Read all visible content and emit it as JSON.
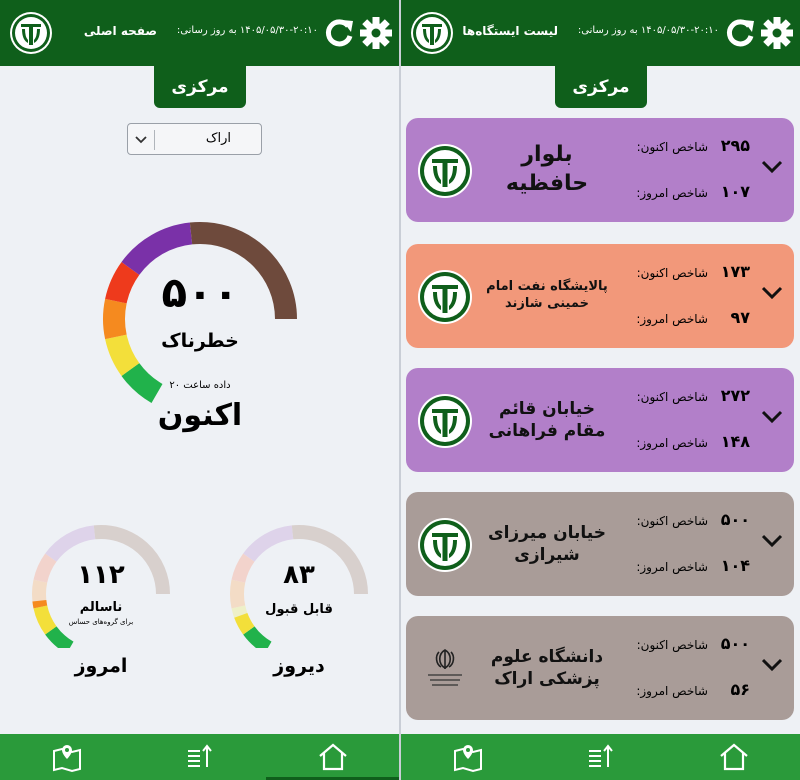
{
  "header_common": {
    "updated_label": "به روز رسانی:",
    "updated_value": "۱۴۰۵/۰۵/۳۰-۲۰:۱۰"
  },
  "left": {
    "header_title": "صفحه اصلی",
    "region": "مرکزی",
    "city_select": {
      "selected": "اراک"
    },
    "current": {
      "value": "۵۰۰",
      "value_num": 500,
      "status": "خطرناک",
      "data_time": "داده ساعت ۲۰",
      "label": "اکنون"
    },
    "today": {
      "value": "۱۱۲",
      "value_num": 112,
      "status": "ناسالم",
      "sub": "برای گروه‌های حساس",
      "label": "امروز"
    },
    "yesterday": {
      "value": "۸۳",
      "value_num": 83,
      "status": "قابل قبول",
      "label": "دیروز"
    }
  },
  "right": {
    "header_title": "لیست ایستگاه‌ها",
    "region": "مرکزی",
    "now_label": "شاخص اکنون:",
    "today_label": "شاخص امروز:",
    "stations": [
      {
        "name": "بلوار حافظیه",
        "now": "۲۹۵",
        "today": "۱۰۷",
        "color": "#b27fc9",
        "logo": "doe",
        "name_size": "big"
      },
      {
        "name": "پالایشگاه نفت امام خمینی شازند",
        "now": "۱۷۳",
        "today": "۹۷",
        "color": "#f2987a",
        "logo": "doe",
        "name_size": "small"
      },
      {
        "name": "خیابان قائم مقام فراهانی",
        "now": "۲۷۲",
        "today": "۱۴۸",
        "color": "#b27fc9",
        "logo": "doe",
        "name_size": "mid"
      },
      {
        "name": "خیابان میرزای شیرازی",
        "now": "۵۰۰",
        "today": "۱۰۴",
        "color": "#a99c98",
        "logo": "doe",
        "name_size": "mid"
      },
      {
        "name": "دانشگاه علوم پزشکی اراک",
        "now": "۵۰۰",
        "today": "۵۶",
        "color": "#a99c98",
        "logo": "emblem",
        "name_size": "mid"
      }
    ]
  },
  "colors": {
    "header_green": "#0f5f1b",
    "nav_green": "#2a9a3a",
    "aqi_good": "#21b24b",
    "aqi_moderate": "#f3df3a",
    "aqi_usg": "#f58a1f",
    "aqi_unhealthy": "#ee3a1c",
    "aqi_very_unhealthy": "#7a31a8",
    "aqi_hazardous": "#6e4a3c"
  },
  "icons": {
    "refresh": "refresh-icon",
    "settings": "gear-icon",
    "nav_map": "map-pin-icon",
    "nav_sort": "sort-list-icon",
    "nav_home": "home-icon"
  }
}
